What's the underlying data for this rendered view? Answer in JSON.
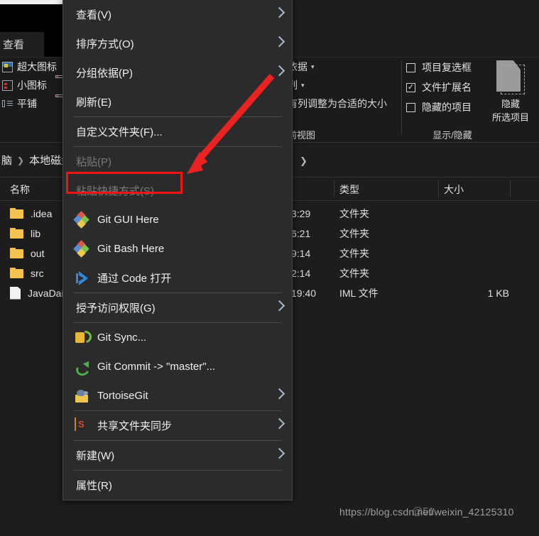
{
  "window": {
    "tab_label": "查看",
    "ribbon": {
      "layout_group": [
        {
          "icon": "extra-large-icons-icon",
          "label": "超大图标"
        },
        {
          "icon": "small-icons-icon",
          "label": "小图标"
        },
        {
          "icon": "tiles-icon",
          "label": "平铺"
        }
      ],
      "current_view_group": [
        {
          "label": "依据",
          "caret": "▾"
        },
        {
          "label": "列",
          "caret": "▾"
        },
        {
          "label": "有列调整为合适的大小",
          "caret": ""
        }
      ],
      "current_view_caption": "前视图",
      "show_hide_group": [
        {
          "label": "项目复选框",
          "checked": false,
          "mark": ""
        },
        {
          "label": "文件扩展名",
          "checked": true,
          "mark": "✓"
        },
        {
          "label": "隐藏的项目",
          "checked": false,
          "mark": ""
        }
      ],
      "hide_selected": {
        "line1": "隐藏",
        "line2": "所选项目"
      },
      "show_hide_caption": "显示/隐藏"
    },
    "address": {
      "crumb_1": "脑",
      "separator": "❯",
      "crumb_2": "本地磁盘",
      "dropdown_chevron": "❯"
    },
    "list": {
      "columns": [
        "名称",
        "类型",
        "大小"
      ],
      "rows": [
        {
          "name": ".idea",
          "icon": "folder-icon",
          "time": "3:29",
          "type": "文件夹",
          "size": ""
        },
        {
          "name": "lib",
          "icon": "folder-icon",
          "time": "6:21",
          "type": "文件夹",
          "size": ""
        },
        {
          "name": "out",
          "icon": "folder-icon",
          "time": "9:14",
          "type": "文件夹",
          "size": ""
        },
        {
          "name": "src",
          "icon": "folder-icon",
          "time": "2:14",
          "type": "文件夹",
          "size": ""
        },
        {
          "name": "JavaDaily",
          "icon": "file-icon",
          "time": "19:40",
          "type": "IML 文件",
          "size": "1 KB"
        }
      ]
    }
  },
  "context_menu": {
    "items": [
      {
        "label": "查看(V)",
        "icon": "",
        "submenu": true,
        "disabled": false,
        "sep_after": false
      },
      {
        "label": "排序方式(O)",
        "icon": "",
        "submenu": true,
        "disabled": false,
        "sep_after": false
      },
      {
        "label": "分组依据(P)",
        "icon": "",
        "submenu": true,
        "disabled": false,
        "sep_after": false
      },
      {
        "label": "刷新(E)",
        "icon": "",
        "submenu": false,
        "disabled": false,
        "sep_after": true
      },
      {
        "label": "自定义文件夹(F)...",
        "icon": "",
        "submenu": false,
        "disabled": false,
        "sep_after": true
      },
      {
        "label": "粘贴(P)",
        "icon": "",
        "submenu": false,
        "disabled": true,
        "sep_after": false
      },
      {
        "label": "粘贴快捷方式(S)",
        "icon": "",
        "submenu": false,
        "disabled": true,
        "sep_after": false
      },
      {
        "label": "Git GUI Here",
        "icon": "git-icon",
        "submenu": false,
        "disabled": false,
        "sep_after": false
      },
      {
        "label": "Git Bash Here",
        "icon": "git-icon",
        "submenu": false,
        "disabled": false,
        "sep_after": false
      },
      {
        "label": "通过 Code 打开",
        "icon": "vscode-icon",
        "submenu": false,
        "disabled": false,
        "sep_after": true
      },
      {
        "label": "授予访问权限(G)",
        "icon": "",
        "submenu": true,
        "disabled": false,
        "sep_after": true
      },
      {
        "label": "Git Sync...",
        "icon": "git-sync-icon",
        "submenu": false,
        "disabled": false,
        "sep_after": false
      },
      {
        "label": "Git Commit -> \"master\"...",
        "icon": "git-commit-icon",
        "submenu": false,
        "disabled": false,
        "sep_after": false
      },
      {
        "label": "TortoiseGit",
        "icon": "tortoisegit-icon",
        "submenu": true,
        "disabled": false,
        "sep_after": true
      },
      {
        "label": "共享文件夹同步",
        "icon": "share-sync-icon",
        "submenu": true,
        "disabled": false,
        "sep_after": true
      },
      {
        "label": "新建(W)",
        "icon": "",
        "submenu": true,
        "disabled": false,
        "sep_after": true
      },
      {
        "label": "属性(R)",
        "icon": "",
        "submenu": false,
        "disabled": false,
        "sep_after": false
      }
    ],
    "highlighted_item": "Git Bash Here"
  },
  "annotations": {
    "highlight_color": "#f01414",
    "arrow_color": "#ea2222"
  },
  "watermark": {
    "url": "https://blog.csdn.net/weixin_42125310",
    "overlay": "@51"
  }
}
